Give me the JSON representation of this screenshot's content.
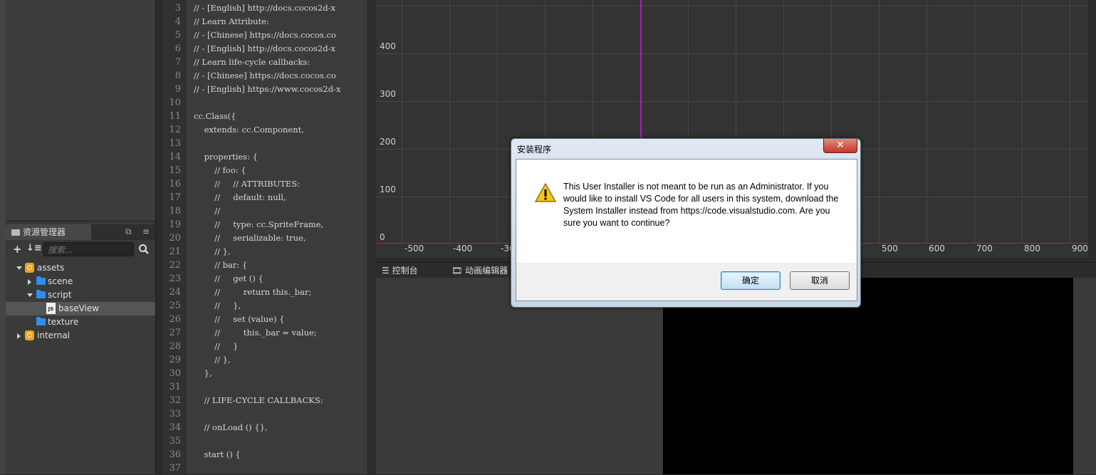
{
  "assets_panel": {
    "tab_label": "资源管理器",
    "search_placeholder": "搜索...",
    "tree": [
      {
        "label": "assets",
        "kind": "db",
        "expanded": true
      },
      {
        "label": "scene",
        "kind": "folder",
        "expanded": false
      },
      {
        "label": "script",
        "kind": "folder",
        "expanded": true
      },
      {
        "label": "baseView",
        "kind": "js",
        "selected": true
      },
      {
        "label": "texture",
        "kind": "folder"
      },
      {
        "label": "internal",
        "kind": "db",
        "expanded": false
      }
    ]
  },
  "editor": {
    "start_line": 3,
    "lines": [
      "// - [English] http://docs.cocos2d-x",
      "// Learn Attribute:",
      "// - [Chinese] https://docs.cocos.co",
      "// - [English] http://docs.cocos2d-x",
      "// Learn life-cycle callbacks:",
      "// - [Chinese] https://docs.cocos.co",
      "// - [English] https://www.cocos2d-x",
      "",
      "cc.Class({",
      "    extends: cc.Component,",
      "",
      "    properties: {",
      "        // foo: {",
      "        //     // ATTRIBUTES:",
      "        //     default: null,",
      "        //",
      "        //     type: cc.SpriteFrame,",
      "        //     serializable: true,",
      "        // },",
      "        // bar: {",
      "        //     get () {",
      "        //         return this._bar;",
      "        //     },",
      "        //     set (value) {",
      "        //         this._bar = value;",
      "        //     }",
      "        // },",
      "    },",
      "",
      "    // LIFE-CYCLE CALLBACKS:",
      "",
      "    // onLoad () {},",
      "",
      "    start () {",
      ""
    ],
    "line_numbers": [
      "3",
      "4",
      "5",
      "6",
      "7",
      "8",
      "9",
      "10",
      "11",
      "12",
      "13",
      "14",
      "15",
      "16",
      "17",
      "18",
      "19",
      "20",
      "21",
      "22",
      "23",
      "24",
      "25",
      "26",
      "27",
      "28",
      "29",
      "30",
      "31",
      "32",
      "33",
      "34",
      "35",
      "36",
      "37"
    ]
  },
  "scene": {
    "y_ticks": [
      "400",
      "300",
      "200",
      "100",
      "0"
    ],
    "x_ticks": [
      "-500",
      "-400",
      "-30",
      "500",
      "600",
      "700",
      "800",
      "900"
    ]
  },
  "bottom_tabs": {
    "console": "控制台",
    "animation": "动画编辑器"
  },
  "dialog": {
    "title": "安装程序",
    "close": "×",
    "message": "This User Installer is not meant to be run as an Administrator. If you would like to install VS Code for all users in this system, download the System Installer instead from https://code.visualstudio.com. Are you sure you want to continue?",
    "ok": "确定",
    "cancel": "取消"
  },
  "colors": {
    "y_axis": "#b01fb5",
    "x_axis": "#a03030",
    "folder": "#2f8ef0",
    "db": "#e8a423"
  }
}
